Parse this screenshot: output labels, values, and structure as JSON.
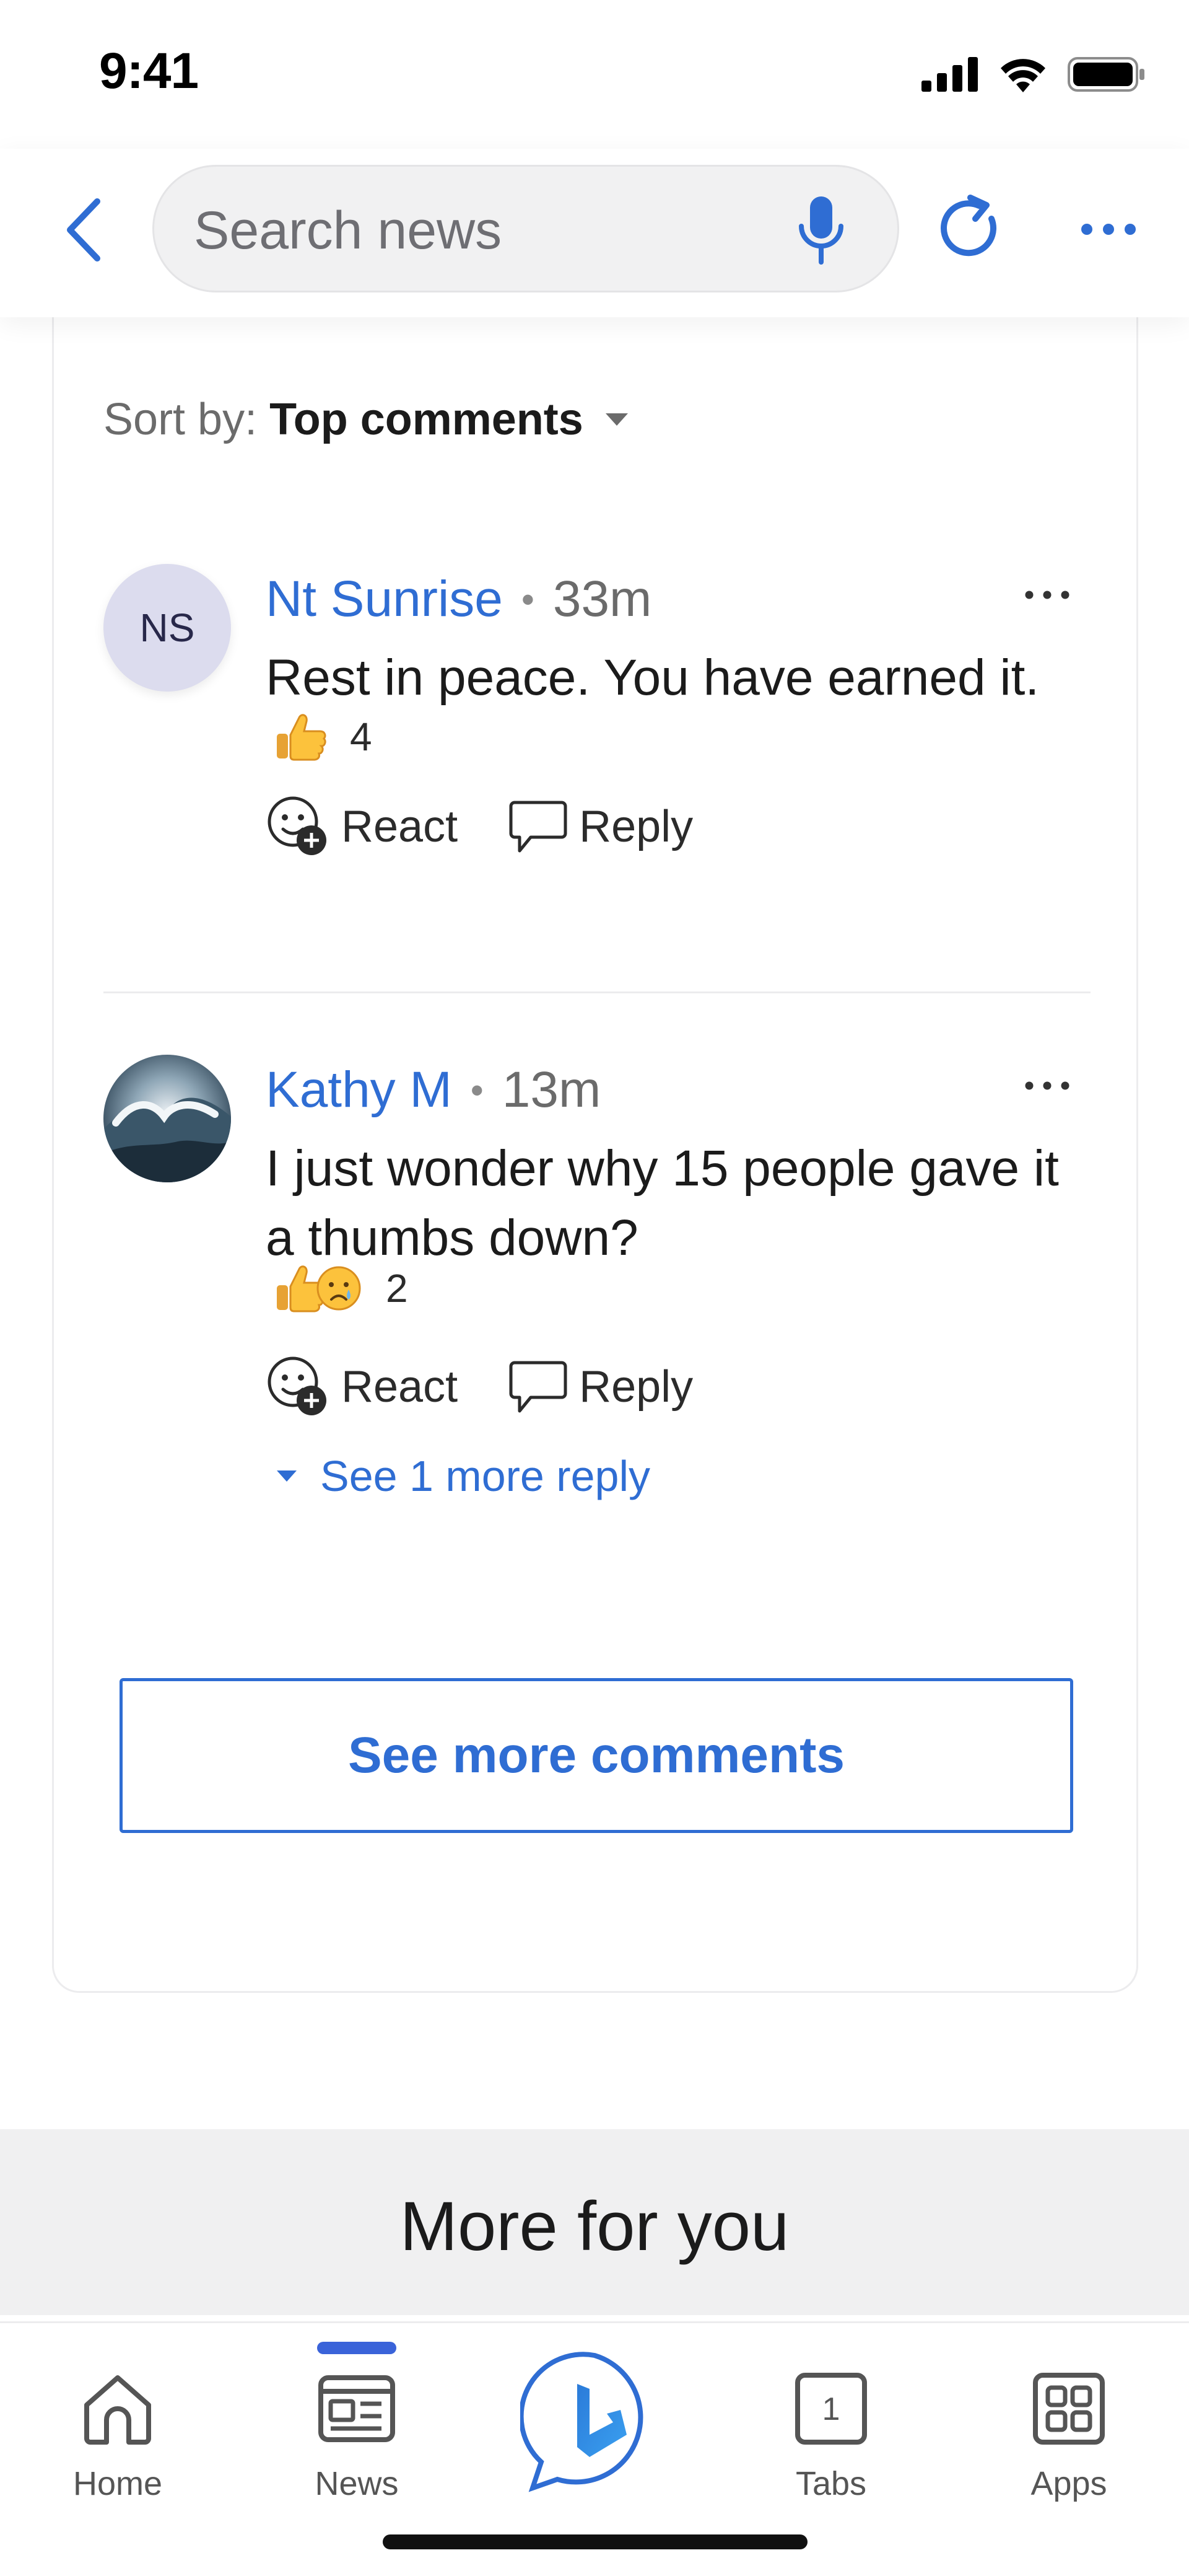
{
  "status_bar": {
    "time": "9:41"
  },
  "header": {
    "search_placeholder": "Search news"
  },
  "sort": {
    "label": "Sort by:",
    "value": "Top comments"
  },
  "comments": [
    {
      "initials": "NS",
      "author": "Nt Sunrise",
      "time": "33m",
      "text": "Rest in peace.  You have earned it.",
      "reaction_count": "4",
      "react_label": "React",
      "reply_label": "Reply"
    },
    {
      "author": "Kathy M",
      "time": "13m",
      "text": "I just wonder why 15 people gave it a thumbs down?",
      "reaction_count": "2",
      "react_label": "React",
      "reply_label": "Reply",
      "see_replies": "See 1 more reply"
    }
  ],
  "see_more_label": "See more comments",
  "more_for_you": "More for you",
  "bottom_nav": {
    "home": "Home",
    "news": "News",
    "tabs": "Tabs",
    "tabs_count": "1",
    "apps": "Apps"
  },
  "colors": {
    "accent": "#2f6dd3",
    "nav_active": "#3a63d9",
    "avatar_bg": "#dcdcee"
  }
}
